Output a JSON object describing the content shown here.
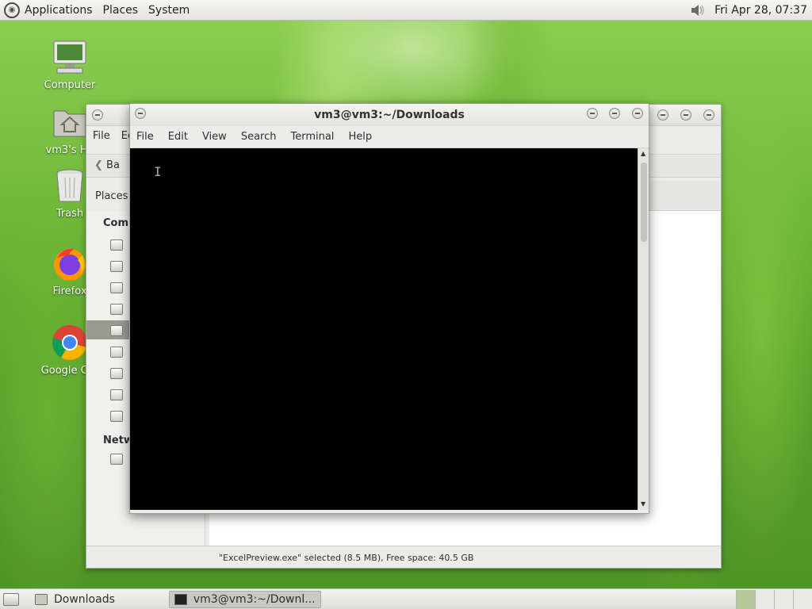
{
  "top_panel": {
    "menus": [
      "Applications",
      "Places",
      "System"
    ],
    "clock": "Fri Apr 28, 07:37"
  },
  "desktop": {
    "icons": [
      {
        "label": "Computer",
        "icon": "computer-icon"
      },
      {
        "label": "vm3's Ho",
        "icon": "home-folder-icon"
      },
      {
        "label": "Trash",
        "icon": "trash-icon"
      },
      {
        "label": "Firefox",
        "icon": "firefox-icon"
      },
      {
        "label": "Google Chr",
        "icon": "chrome-icon"
      }
    ]
  },
  "file_manager": {
    "menu": [
      "File",
      "Ec"
    ],
    "back_label": "Ba",
    "places_label": "Places",
    "sections": [
      "Comp",
      "Netw"
    ],
    "status": "\"ExcelPreview.exe\" selected (8.5 MB), Free space: 40.5 GB"
  },
  "terminal": {
    "title": "vm3@vm3:~/Downloads",
    "menu": [
      "File",
      "Edit",
      "View",
      "Search",
      "Terminal",
      "Help"
    ],
    "cursor": "I"
  },
  "bottom_panel": {
    "tasks": [
      "Downloads",
      "vm3@vm3:~/Downl..."
    ]
  },
  "colors": {
    "terminal_bg": "#000000",
    "panel_bg": "#ececea",
    "wallpaper_green": "#6fb83a"
  }
}
